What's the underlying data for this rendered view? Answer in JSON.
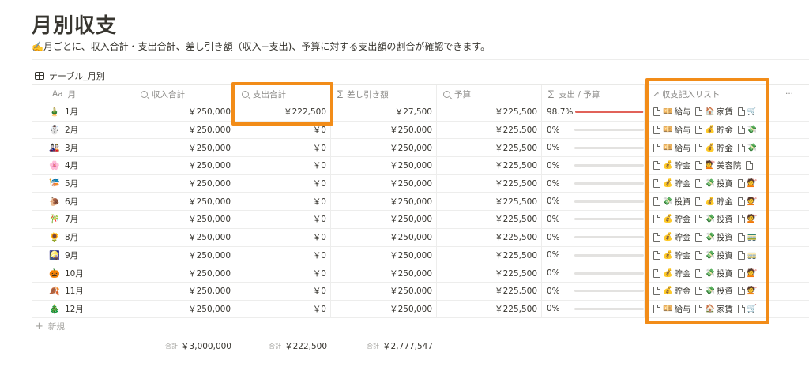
{
  "page": {
    "title": "月別収支",
    "description": "✍️月ごとに、収入合計・支出合計、差し引き額（収入−支出)、予算に対する支出額の割合が確認できます。",
    "view_name": "テーブル_月別"
  },
  "columns": {
    "month": "月",
    "month_type": "Aa",
    "income": "収入合計",
    "expense": "支出合計",
    "diff": "差し引き額",
    "budget": "予算",
    "ratio": "支出 / 予算",
    "list": "収支記入リスト",
    "more": "···",
    "sigma": "∑",
    "arrow": "↗"
  },
  "rows": [
    {
      "icon": "🎍",
      "month": "1月",
      "income": "￥250,000",
      "expense": "￥222,500",
      "diff": "￥27,500",
      "budget": "￥225,500",
      "ratio": "98.7%",
      "ratio_value": 0.987,
      "tags": [
        {
          "e": "💴",
          "t": "給与"
        },
        {
          "e": "🏠",
          "t": "家賃"
        },
        {
          "e": "🛒",
          "t": ""
        }
      ]
    },
    {
      "icon": "☃️",
      "month": "2月",
      "income": "￥250,000",
      "expense": "￥0",
      "diff": "￥250,000",
      "budget": "￥225,500",
      "ratio": "0%",
      "ratio_value": 0,
      "tags": [
        {
          "e": "💴",
          "t": "給与"
        },
        {
          "e": "💰",
          "t": "貯金"
        },
        {
          "e": "💸",
          "t": ""
        }
      ]
    },
    {
      "icon": "🎎",
      "month": "3月",
      "income": "￥250,000",
      "expense": "￥0",
      "diff": "￥250,000",
      "budget": "￥225,500",
      "ratio": "0%",
      "ratio_value": 0,
      "tags": [
        {
          "e": "💴",
          "t": "給与"
        },
        {
          "e": "💰",
          "t": "貯金"
        },
        {
          "e": "💸",
          "t": ""
        }
      ]
    },
    {
      "icon": "🌸",
      "month": "4月",
      "income": "￥250,000",
      "expense": "￥0",
      "diff": "￥250,000",
      "budget": "￥225,500",
      "ratio": "0%",
      "ratio_value": 0,
      "tags": [
        {
          "e": "💰",
          "t": "貯金"
        },
        {
          "e": "💇",
          "t": "美容院"
        },
        {
          "e": "",
          "t": ""
        }
      ]
    },
    {
      "icon": "🎏",
      "month": "5月",
      "income": "￥250,000",
      "expense": "￥0",
      "diff": "￥250,000",
      "budget": "￥225,500",
      "ratio": "0%",
      "ratio_value": 0,
      "tags": [
        {
          "e": "💰",
          "t": "貯金"
        },
        {
          "e": "💸",
          "t": "投資"
        },
        {
          "e": "💇",
          "t": ""
        }
      ]
    },
    {
      "icon": "🐌",
      "month": "6月",
      "income": "￥250,000",
      "expense": "￥0",
      "diff": "￥250,000",
      "budget": "￥225,500",
      "ratio": "0%",
      "ratio_value": 0,
      "tags": [
        {
          "e": "💸",
          "t": "投資"
        },
        {
          "e": "💰",
          "t": "貯金"
        },
        {
          "e": "💇",
          "t": ""
        }
      ]
    },
    {
      "icon": "🎋",
      "month": "7月",
      "income": "￥250,000",
      "expense": "￥0",
      "diff": "￥250,000",
      "budget": "￥225,500",
      "ratio": "0%",
      "ratio_value": 0,
      "tags": [
        {
          "e": "💰",
          "t": "貯金"
        },
        {
          "e": "💸",
          "t": "投資"
        },
        {
          "e": "💇",
          "t": ""
        }
      ]
    },
    {
      "icon": "🌻",
      "month": "8月",
      "income": "￥250,000",
      "expense": "￥0",
      "diff": "￥250,000",
      "budget": "￥225,500",
      "ratio": "0%",
      "ratio_value": 0,
      "tags": [
        {
          "e": "💰",
          "t": "貯金"
        },
        {
          "e": "💸",
          "t": "投資"
        },
        {
          "e": "🚃",
          "t": ""
        }
      ]
    },
    {
      "icon": "🎑",
      "month": "9月",
      "income": "￥250,000",
      "expense": "￥0",
      "diff": "￥250,000",
      "budget": "￥225,500",
      "ratio": "0%",
      "ratio_value": 0,
      "tags": [
        {
          "e": "💰",
          "t": "貯金"
        },
        {
          "e": "💸",
          "t": "投資"
        },
        {
          "e": "🚃",
          "t": ""
        }
      ]
    },
    {
      "icon": "🎃",
      "month": "10月",
      "income": "￥250,000",
      "expense": "￥0",
      "diff": "￥250,000",
      "budget": "￥225,500",
      "ratio": "0%",
      "ratio_value": 0,
      "tags": [
        {
          "e": "💰",
          "t": "貯金"
        },
        {
          "e": "💸",
          "t": "投資"
        },
        {
          "e": "💇",
          "t": ""
        }
      ]
    },
    {
      "icon": "🍂",
      "month": "11月",
      "income": "￥250,000",
      "expense": "￥0",
      "diff": "￥250,000",
      "budget": "￥225,500",
      "ratio": "0%",
      "ratio_value": 0,
      "tags": [
        {
          "e": "💰",
          "t": "貯金"
        },
        {
          "e": "💸",
          "t": "投資"
        },
        {
          "e": "💇",
          "t": ""
        }
      ]
    },
    {
      "icon": "🎄",
      "month": "12月",
      "income": "￥250,000",
      "expense": "￥0",
      "diff": "￥250,000",
      "budget": "￥225,500",
      "ratio": "0%",
      "ratio_value": 0,
      "tags": [
        {
          "e": "💴",
          "t": "給与"
        },
        {
          "e": "🏠",
          "t": "家賃"
        },
        {
          "e": "🛒",
          "t": ""
        }
      ]
    }
  ],
  "new_row": "新規",
  "totals": {
    "label": "合計",
    "income": "￥3,000,000",
    "expense": "￥222,500",
    "diff": "￥2,777,547"
  },
  "colors": {
    "highlight": "#f28c18",
    "bar_fill": "#e16259",
    "bar_track": "#e3e2e0"
  }
}
